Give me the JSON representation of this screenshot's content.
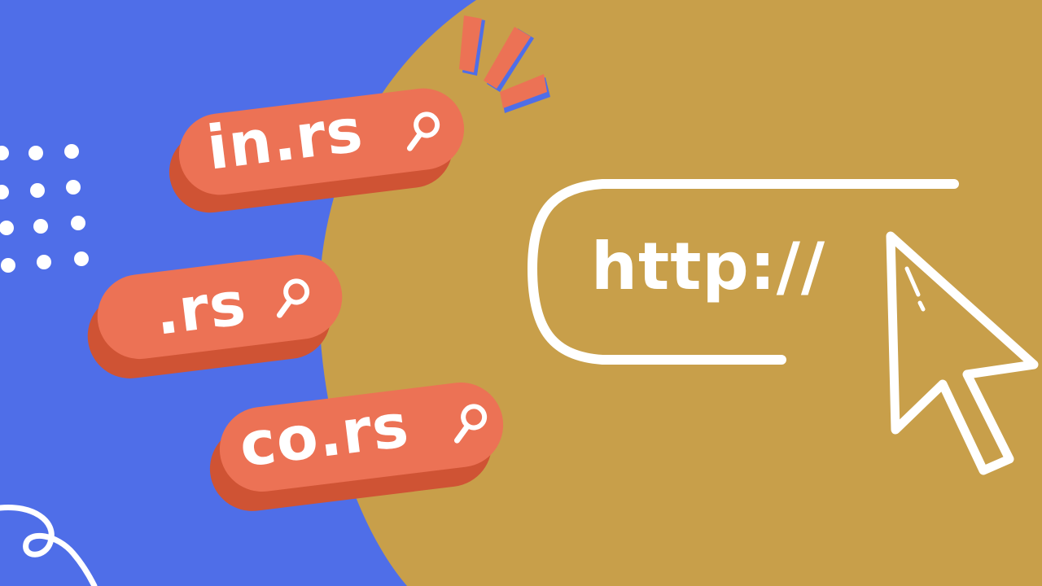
{
  "colors": {
    "background_blue": "#4f6ee8",
    "panel_gold": "#c89f4a",
    "pill_coral": "#ec7255",
    "pill_shadow": "#cf5334",
    "white": "#ffffff"
  },
  "domains": [
    {
      "label": "in.rs",
      "icon": "magnifier-icon"
    },
    {
      "label": ".rs",
      "icon": "magnifier-icon"
    },
    {
      "label": "co.rs",
      "icon": "magnifier-icon"
    }
  ],
  "url_field": {
    "text": "http://"
  },
  "icons": [
    "cursor-arrow-icon",
    "dots-pattern",
    "squiggle-line",
    "exclamation-marks"
  ]
}
